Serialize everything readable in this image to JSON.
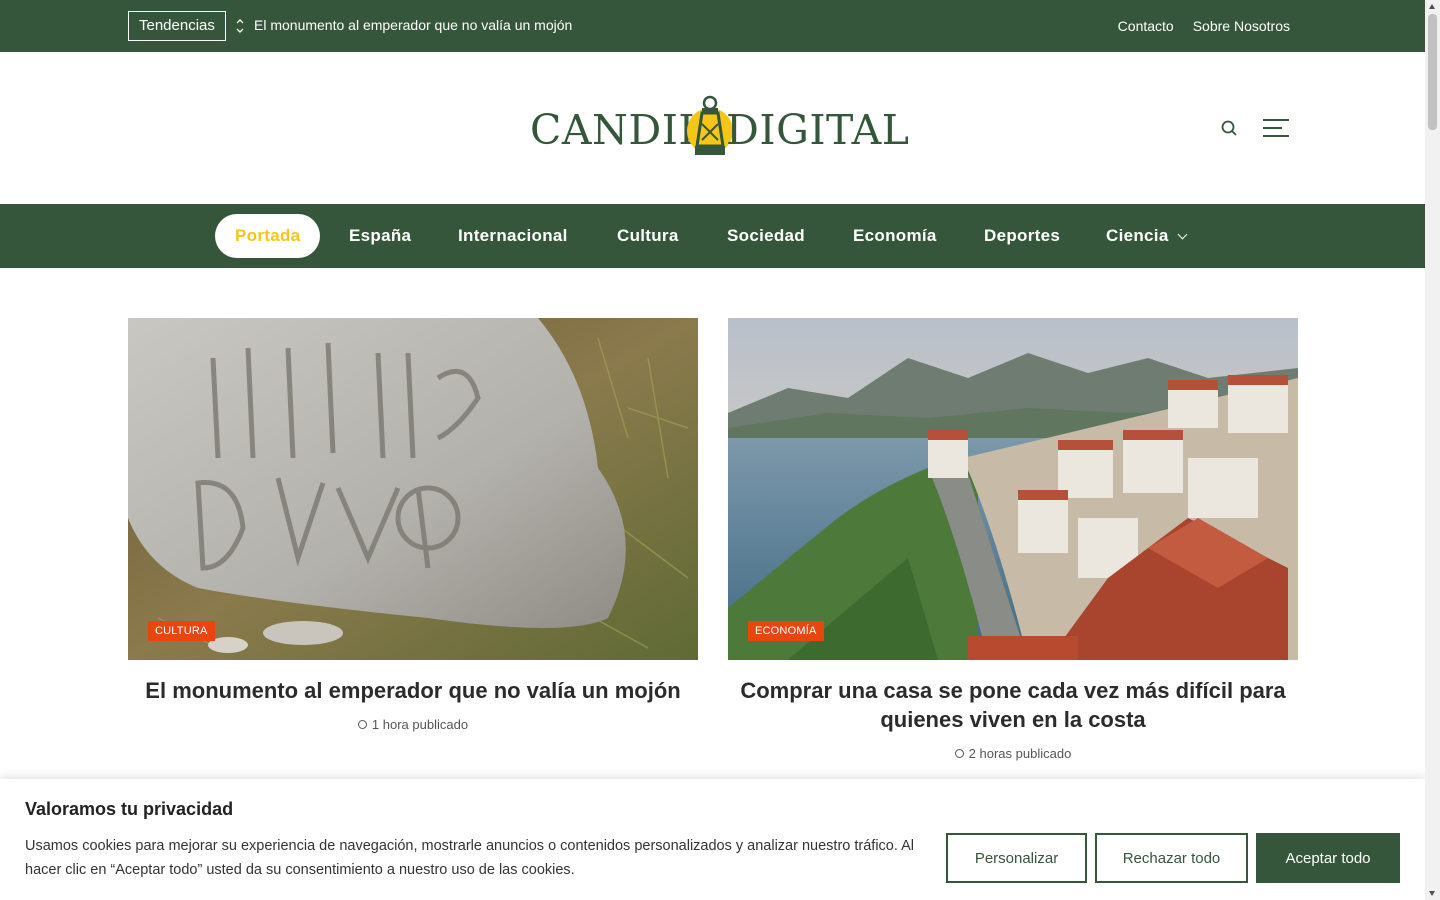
{
  "topbar": {
    "trending_label": "Tendencias",
    "ticker_text": "El monumento al emperador que no valía un mojón",
    "links": [
      "Contacto",
      "Sobre Nosotros"
    ]
  },
  "header": {
    "logo_word_1": "CANDIL",
    "logo_word_2": "DIGITAL",
    "brand_color": "#35563a",
    "accent_color": "#f5c518"
  },
  "nav": {
    "items": [
      "Portada",
      "España",
      "Internacional",
      "Cultura",
      "Sociedad",
      "Economía",
      "Deportes",
      "Ciencia"
    ],
    "active": "Portada"
  },
  "articles": [
    {
      "category": "CULTURA",
      "title": "El monumento al emperador que no valía un mojón",
      "time": "1 hora publicado"
    },
    {
      "category": "ECONOMÍA",
      "title": "Comprar una casa se pone cada vez más difícil para quienes viven en la costa",
      "time": "2 horas publicado"
    }
  ],
  "cookie": {
    "title": "Valoramos tu privacidad",
    "text": "Usamos cookies para mejorar su experiencia de navegación, mostrarle anuncios o contenidos personalizados y analizar nuestro tráfico. Al hacer clic en “Aceptar todo” usted da su consentimiento a nuestro uso de las cookies.",
    "customize_label": "Personalizar",
    "reject_label": "Rechazar todo",
    "accept_label": "Aceptar todo"
  },
  "icons": {
    "ticker": "updown-chevron-icon",
    "search": "search-icon",
    "menu": "hamburger-menu-icon",
    "clock": "clock-icon"
  }
}
